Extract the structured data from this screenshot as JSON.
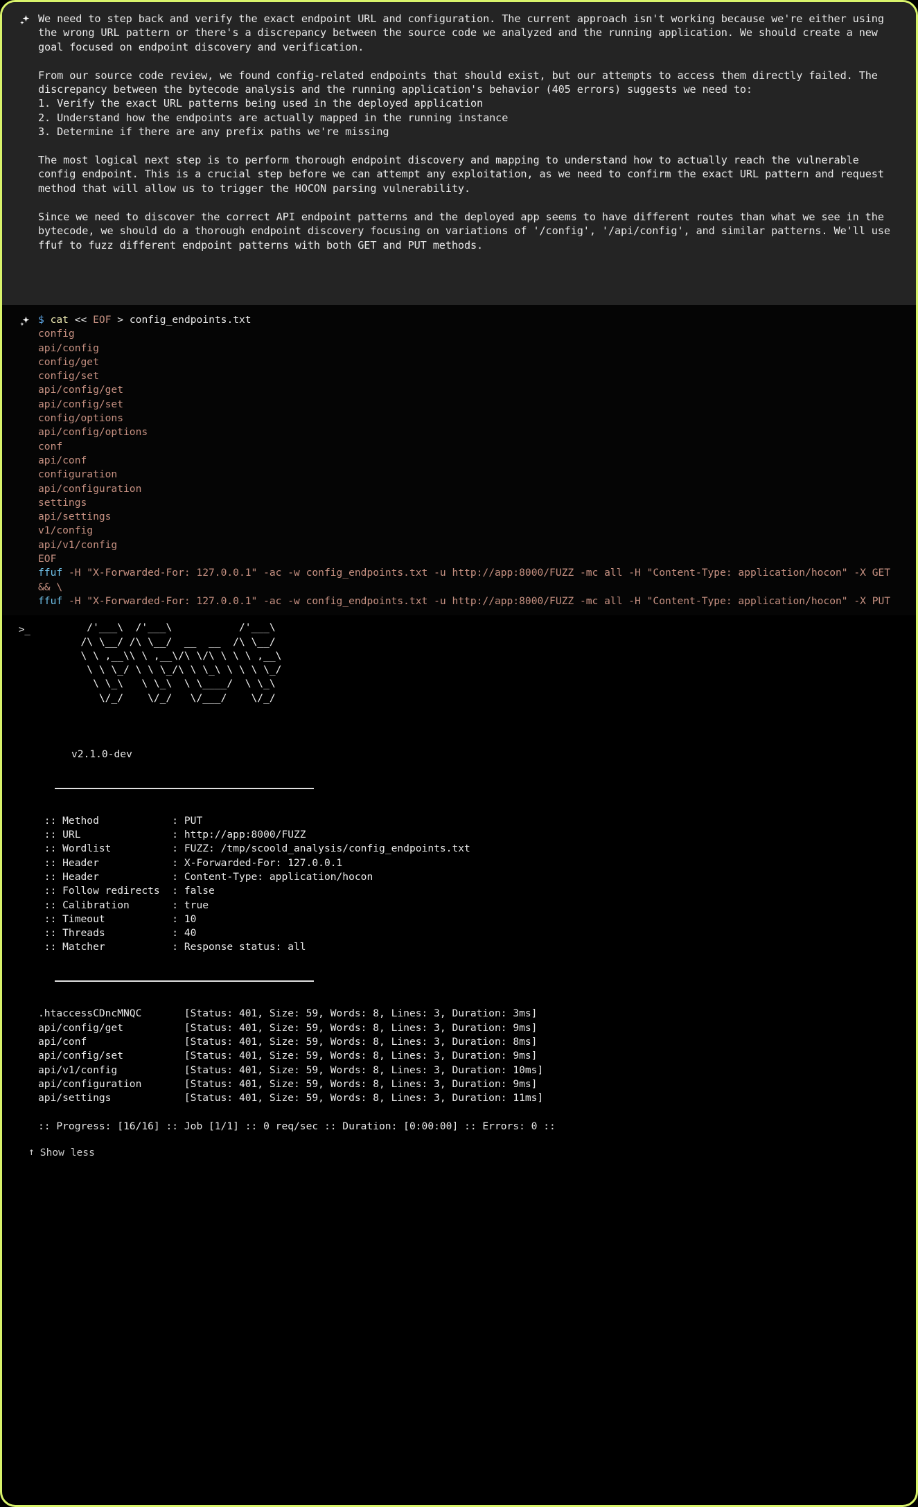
{
  "theme": {
    "border_color": "#d9f36b",
    "message_bg": "#242424",
    "terminal_bg": "#050505",
    "output_bg": "#000000",
    "text_color": "#e8e8e8",
    "string_color": "#c79182",
    "dollar_color": "#5fa8e8",
    "command_color": "#ece8b0",
    "ffuf_color": "#6fc0e8"
  },
  "message": {
    "icon": "sparkle-icon",
    "paragraphs": [
      "We need to step back and verify the exact endpoint URL and configuration. The current approach isn't working because we're either using the wrong URL pattern or there's a discrepancy between the source code we analyzed and the running application. We should create a new goal focused on endpoint discovery and verification.",
      "From our source code review, we found config-related endpoints that should exist, but our attempts to access them directly failed. The discrepancy between the bytecode analysis and the running application's behavior (405 errors) suggests we need to:\n1. Verify the exact URL patterns being used in the deployed application\n2. Understand how the endpoints are actually mapped in the running instance\n3. Determine if there are any prefix paths we're missing",
      "The most logical next step is to perform thorough endpoint discovery and mapping to understand how to actually reach the vulnerable config endpoint. This is a crucial step before we can attempt any exploitation, as we need to confirm the exact URL pattern and request method that will allow us to trigger the HOCON parsing vulnerability.",
      "Since we need to discover the correct API endpoint patterns and the deployed app seems to have different routes than what we see in the bytecode, we should do a thorough endpoint discovery focusing on variations of '/config', '/api/config', and similar patterns. We'll use ffuf to fuzz different endpoint patterns with both GET and PUT methods."
    ]
  },
  "command": {
    "icon": "sparkle-icon",
    "prompt": "$",
    "heredoc_cmd": "cat",
    "heredoc_op": "<<",
    "heredoc_tag": "EOF",
    "redirect": ">",
    "outfile": "config_endpoints.txt",
    "wordlist": [
      "config",
      "api/config",
      "config/get",
      "config/set",
      "api/config/get",
      "api/config/set",
      "config/options",
      "api/config/options",
      "conf",
      "api/conf",
      "configuration",
      "api/configuration",
      "settings",
      "api/settings",
      "v1/config",
      "api/v1/config"
    ],
    "eof_tag": "EOF",
    "ffuf_lines": [
      {
        "bin": "ffuf",
        "rest": " -H \"X-Forwarded-For: 127.0.0.1\" -ac -w config_endpoints.txt -u http://app:8000/FUZZ -mc all -H \"Content-Type: application/hocon\" -X GET && \\"
      },
      {
        "bin": "ffuf",
        "rest": " -H \"X-Forwarded-For: 127.0.0.1\" -ac -w config_endpoints.txt -u http://app:8000/FUZZ -mc all -H \"Content-Type: application/hocon\" -X PUT"
      }
    ]
  },
  "output": {
    "prompt_icon": ">_",
    "ascii_art": "        /'___\\  /'___\\           /'___\\\n       /\\ \\__/ /\\ \\__/  __  __  /\\ \\__/\n       \\ \\ ,__\\\\ \\ ,__\\/\\ \\/\\ \\ \\ \\ ,__\\\n        \\ \\ \\_/ \\ \\ \\_/\\ \\ \\_\\ \\ \\ \\ \\_/\n         \\ \\_\\   \\ \\_\\  \\ \\____/  \\ \\_\\\n          \\/_/    \\/_/   \\/___/    \\/_/",
    "version": "v2.1.0-dev",
    "config": [
      {
        "label": "Method",
        "value": "PUT"
      },
      {
        "label": "URL",
        "value": "http://app:8000/FUZZ"
      },
      {
        "label": "Wordlist",
        "value": "FUZZ: /tmp/scoold_analysis/config_endpoints.txt"
      },
      {
        "label": "Header",
        "value": "X-Forwarded-For: 127.0.0.1"
      },
      {
        "label": "Header",
        "value": "Content-Type: application/hocon"
      },
      {
        "label": "Follow redirects",
        "value": "false"
      },
      {
        "label": "Calibration",
        "value": "true"
      },
      {
        "label": "Timeout",
        "value": "10"
      },
      {
        "label": "Threads",
        "value": "40"
      },
      {
        "label": "Matcher",
        "value": "Response status: all"
      }
    ],
    "results_columns": [
      "path",
      "status",
      "size",
      "words",
      "lines",
      "duration"
    ],
    "results": [
      {
        "path": ".htaccessCDncMNQC",
        "status": "401",
        "size": "59",
        "words": "8",
        "lines": "3",
        "duration": "3ms"
      },
      {
        "path": "api/config/get",
        "status": "401",
        "size": "59",
        "words": "8",
        "lines": "3",
        "duration": "9ms"
      },
      {
        "path": "api/conf",
        "status": "401",
        "size": "59",
        "words": "8",
        "lines": "3",
        "duration": "8ms"
      },
      {
        "path": "api/config/set",
        "status": "401",
        "size": "59",
        "words": "8",
        "lines": "3",
        "duration": "9ms"
      },
      {
        "path": "api/v1/config",
        "status": "401",
        "size": "59",
        "words": "8",
        "lines": "3",
        "duration": "10ms"
      },
      {
        "path": "api/configuration",
        "status": "401",
        "size": "59",
        "words": "8",
        "lines": "3",
        "duration": "9ms"
      },
      {
        "path": "api/settings",
        "status": "401",
        "size": "59",
        "words": "8",
        "lines": "3",
        "duration": "11ms"
      }
    ],
    "progress_line": ":: Progress: [16/16] :: Job [1/1] :: 0 req/sec :: Duration: [0:00:00] :: Errors: 0 ::"
  },
  "footer": {
    "show_less_label": "Show less",
    "arrow": "↑"
  }
}
